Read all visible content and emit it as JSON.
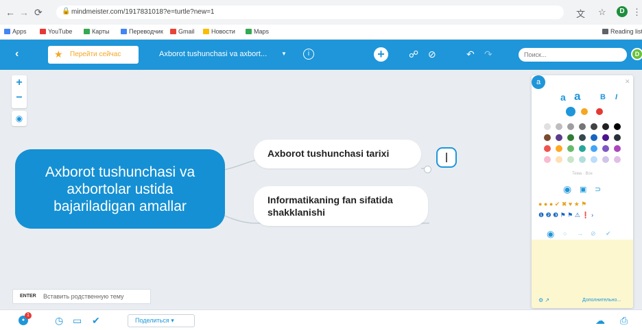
{
  "browser": {
    "url": "mindmeister.com/1917831018?e=turtle?new=1",
    "profile_initial": "D",
    "bookmarks": [
      {
        "label": "Apps",
        "color": "#4285f4"
      },
      {
        "label": "YouTube",
        "color": "#e53935"
      },
      {
        "label": "Карты",
        "color": "#34a853"
      },
      {
        "label": "Переводчик",
        "color": "#4285f4"
      },
      {
        "label": "Gmail",
        "color": "#ea4335"
      },
      {
        "label": "Новости",
        "color": "#fbbc05"
      },
      {
        "label": "Maps",
        "color": "#34a853"
      }
    ],
    "reading_list": "Reading list"
  },
  "toolbar": {
    "upgrade_label": "Перейти сейчас",
    "map_title": "Axborot tushunchasi va axbort...",
    "search_placeholder": "Поиск...",
    "avatar_initial": "D",
    "accent": "#1e96d9"
  },
  "mindmap": {
    "root": "Axborot tushunchasi va axbortolar ustida bajariladigan amallar",
    "children": [
      {
        "text": "Axborot tushunchasi tarixi"
      },
      {
        "text": "Informatikaning fan sifatida shakklanishi"
      }
    ]
  },
  "hint": {
    "key": "ENTER",
    "text": "Вставить родственную тему"
  },
  "style_panel": {
    "colors": [
      "#1e96d9",
      "#f5a623",
      "#e53935",
      "#e0e0e0",
      "#bdbdbd",
      "#9e9e9e",
      "#757575",
      "#424242",
      "#212121",
      "#000000",
      "#7b4a2f",
      "#5d3b8a",
      "#2e7d32",
      "#37474f",
      "#1565c0",
      "#4a148c",
      "#263238",
      "#ef5350",
      "#ffa726",
      "#66bb6a",
      "#26a69a",
      "#42a5f5",
      "#7e57c2",
      "#ab47bc",
      "#f8bbd0",
      "#ffe0b2",
      "#c8e6c9",
      "#b2dfdb",
      "#bbdefb",
      "#d1c4e9",
      "#e1bee7"
    ],
    "palette_label": "Тема · Все",
    "advanced_link": "Дополнительно..."
  },
  "bottom": {
    "notification_count": "1",
    "share_label": "Поделиться ▾"
  }
}
